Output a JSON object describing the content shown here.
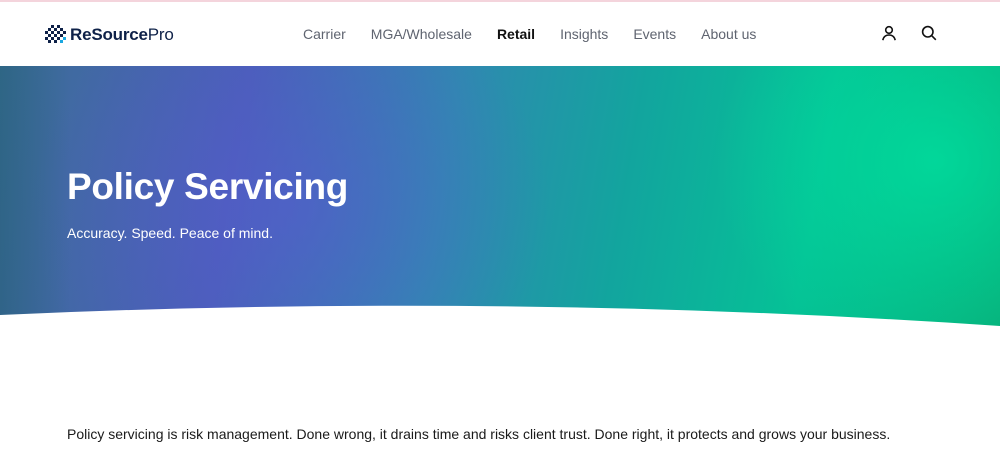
{
  "header": {
    "logo": {
      "text_bold": "ReSource",
      "text_light": "Pro",
      "icon": "checkered-globe-icon"
    },
    "nav": [
      {
        "label": "Carrier",
        "active": false
      },
      {
        "label": "MGA/Wholesale",
        "active": false
      },
      {
        "label": "Retail",
        "active": true
      },
      {
        "label": "Insights",
        "active": false
      },
      {
        "label": "Events",
        "active": false
      },
      {
        "label": "About us",
        "active": false
      }
    ],
    "icons": [
      "user-icon",
      "search-icon"
    ]
  },
  "hero": {
    "title": "Policy Servicing",
    "subtitle": "Accuracy. Speed. Peace of mind."
  },
  "main": {
    "intro": "Policy servicing is risk management. Done wrong, it drains time and risks client trust. Done right, it protects and grows your business."
  },
  "colors": {
    "brand_navy": "#0e2148",
    "hero_purple": "#4a5fb8",
    "hero_green": "#05c296",
    "nav_text": "#5f6470"
  }
}
